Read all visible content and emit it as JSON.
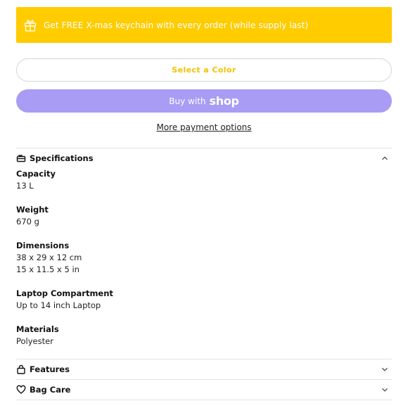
{
  "promo": {
    "text": "Get FREE X-mas keychain with every order (while supply last)",
    "icon": "gift-icon",
    "bg": "#FFCC00"
  },
  "select_color_label": "Select a Color",
  "buy_button": {
    "label": "Buy with",
    "brand": "shop",
    "bg": "#A99CF4"
  },
  "more_payment_options": "More payment options",
  "specifications": {
    "title": "Specifications",
    "icon": "bag-icon",
    "expanded": true,
    "items": [
      {
        "label": "Capacity",
        "values": [
          "13 L"
        ]
      },
      {
        "label": "Weight",
        "values": [
          "670 g"
        ]
      },
      {
        "label": "Dimensions",
        "values": [
          "38 x 29 x 12 cm",
          "15 x 11.5 x 5 in"
        ]
      },
      {
        "label": "Laptop Compartment",
        "values": [
          "Up to 14 inch Laptop"
        ]
      },
      {
        "label": "Materials",
        "values": [
          "Polyester"
        ]
      }
    ]
  },
  "features": {
    "title": "Features",
    "icon": "lock-bag-icon"
  },
  "bag_care": {
    "title": "Bag Care",
    "icon": "heart-icon"
  }
}
